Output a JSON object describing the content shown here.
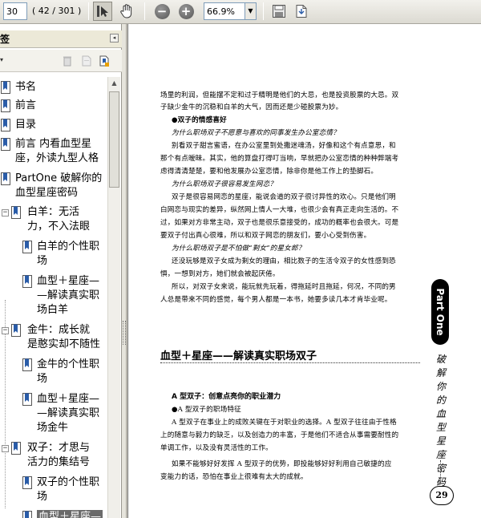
{
  "toolbar": {
    "page_number": "30",
    "page_count": "( 42 / 301 )",
    "zoom": "66.9%",
    "icons": [
      "select-tool-icon",
      "hand-tool-icon",
      "zoom-out-icon",
      "zoom-in-icon",
      "save-icon",
      "export-icon"
    ]
  },
  "bookmarks_panel": {
    "title": "签",
    "items": [
      {
        "label": "书名",
        "lines": [
          "书名"
        ]
      },
      {
        "label": "前言",
        "lines": [
          "前言"
        ]
      },
      {
        "label": "目录",
        "lines": [
          "目录"
        ]
      },
      {
        "label": "前言 内看血型星座，外读九型人格",
        "lines": [
          "前言 内看血型星",
          "座，外读九型人格"
        ]
      },
      {
        "label": "PartOne 破解你的血型星座密码",
        "lines": [
          "PartOne 破解你的",
          "血型星座密码"
        ]
      },
      {
        "label": "白羊：无活力，不入法眼",
        "lines": [
          "白羊：无活",
          "力，不入法眼"
        ]
      },
      {
        "label": "白羊的个性职场",
        "lines": [
          "白羊的个性职",
          "场"
        ]
      },
      {
        "label": "血型＋星座——解读真实职场白羊",
        "lines": [
          "血型＋星座—",
          "—解读真实职",
          "场白羊"
        ]
      },
      {
        "label": "金牛：成长就是憨实却不随性",
        "lines": [
          "金牛：成长就",
          "是憨实却不随性"
        ]
      },
      {
        "label": "金牛的个性职场",
        "lines": [
          "金牛的个性职",
          "场"
        ]
      },
      {
        "label": "血型＋星座——解读真实职场金牛",
        "lines": [
          "血型＋星座—",
          "—解读真实职",
          "场金牛"
        ]
      },
      {
        "label": "双子：才思与活力的集结号",
        "lines": [
          "双子：才思与",
          "活力的集结号"
        ]
      },
      {
        "label": "双子的个性职场",
        "lines": [
          "双子的个性职",
          "场"
        ]
      },
      {
        "label": "血型＋星座——",
        "lines": [
          "血型＋星座—"
        ]
      }
    ]
  },
  "document": {
    "paragraphs": [
      "场里的利润，但能摆不定和过于精明是他们的大忌，也是投资股票的大忌。双",
      "子缺少金牛的沉稳和白羊的大气，因而还是少碰股票为妙。",
      "●双子的情感喜好",
      "为什么职场双子不愿意与喜欢的同事发生办公室恋情？",
      "别看双子甜言蜜语，在办公室里到处撒迷魂汤，好像和这个有点意思，和",
      "那个有点暧昧。其实，他的算盘打得叮当响，早就把办公室恋情的种种弊端考",
      "虑得清清楚楚，要和他发展办公室恋情，除非你是他工作上的垫脚石。",
      "为什么职场双子很容易发生网恋？",
      "双子是很容易网恋的星座，能说会道的双子很讨异性的欢心。只是他们明",
      "白网恋与现实的差异，纵然网上情人一大堆，也很少会有真正走向生活的。不",
      "过，如果对方非常主动，双子也是很乐意接受的，成功的概率也会很大。可是",
      "要双子付出真心很难，所以和双子网恋的朋友们，要小心受到伤害。",
      "为什么职场双子是不怕做“剩女”的星女郎？",
      "还没玩够是双子女成为剩女的理由，相比数子的生活令双子的女性感到恐",
      "惧，一想到对方，她们就会被起厌倦。",
      "所以，对双子女来说，能玩就先玩着，得拖延时且拖延，何况，不同的男",
      "人总是带来不同的感觉，每个男人都是一本书，她要多读几本才肯毕业呢。",
      "A 型双子：创意点亮你的职业潜力",
      "●A 型双子的职场特征",
      "A 型双子在事业上的成败关键在于对职业的选择。A 型双子往往由于性格",
      "上的随意与毅力的缺乏，以及创造力的丰富，于是他们不适合从事需要耐性的",
      "单调工作，以及没有灵活性的工作。",
      "如果不能够好好发挥 A 型双子的优势，即投能够好好利用自己敏捷的应",
      "变能力的话，恐怕在事业上很难有太大的成就。"
    ],
    "section_heading": "血型＋星座——解读真实职场双子",
    "side_tab": "Part One",
    "side_vertical_text": "破解你的血型星座密码",
    "page_number": "29"
  }
}
